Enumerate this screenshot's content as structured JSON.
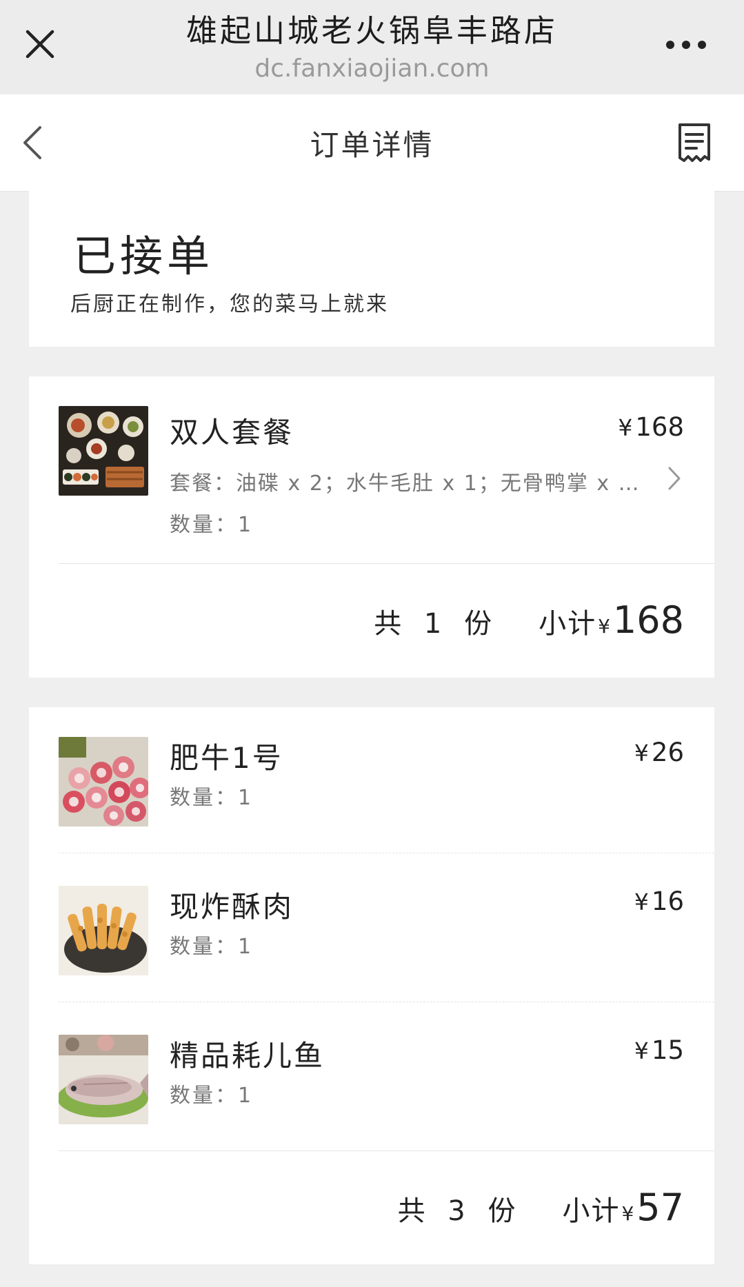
{
  "browser": {
    "title": "雄起山城老火锅阜丰路店",
    "url": "dc.fanxiaojian.com"
  },
  "nav": {
    "title": "订单详情"
  },
  "status": {
    "title": "已接单",
    "subtitle": "后厨正在制作，您的菜马上就来"
  },
  "orders": [
    {
      "items": [
        {
          "name": "双人套餐",
          "currency": "¥",
          "price": "168",
          "desc": "套餐：油碟 x 2；水牛毛肚 x 1；无骨鸭掌 x …",
          "qty": "数量：1"
        }
      ],
      "count_text": "共 1 份",
      "subtotal_label": "小计",
      "currency": "¥",
      "subtotal": "168"
    },
    {
      "items": [
        {
          "name": "肥牛1号",
          "currency": "¥",
          "price": "26",
          "qty": "数量：1"
        },
        {
          "name": "现炸酥肉",
          "currency": "¥",
          "price": "16",
          "qty": "数量：1"
        },
        {
          "name": "精品耗儿鱼",
          "currency": "¥",
          "price": "15",
          "qty": "数量：1"
        }
      ],
      "count_text": "共 3 份",
      "subtotal_label": "小计",
      "currency": "¥",
      "subtotal": "57"
    }
  ]
}
